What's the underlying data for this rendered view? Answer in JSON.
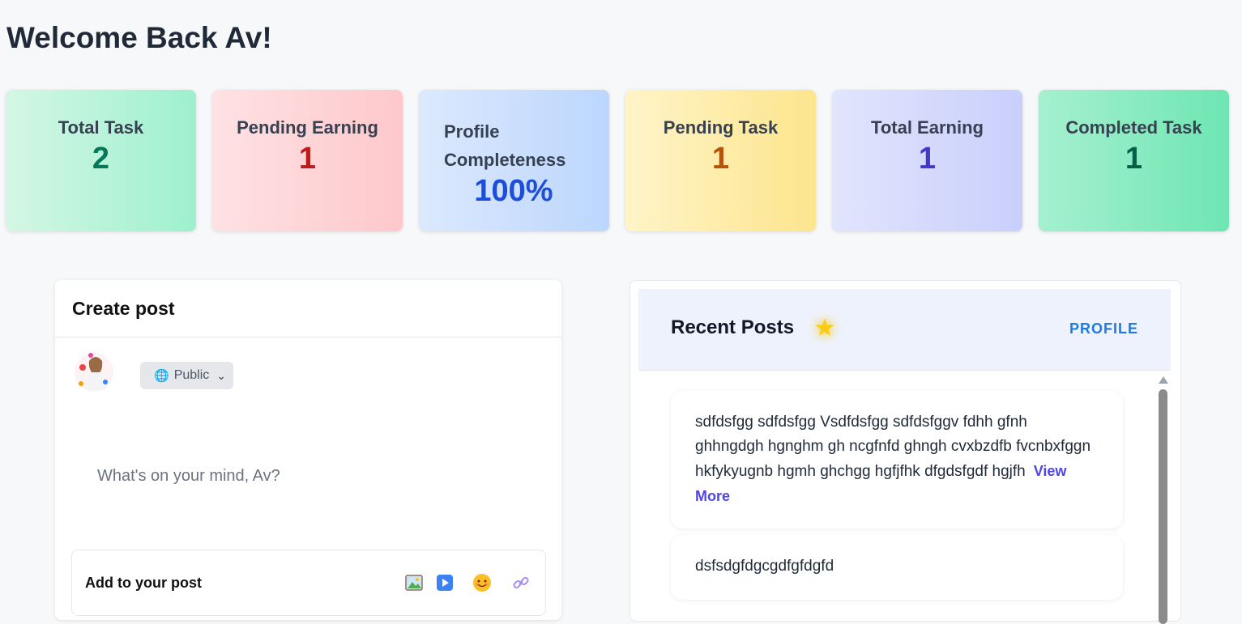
{
  "welcome": "Welcome Back Av!",
  "stats": [
    {
      "label": "Total Task",
      "value": "2",
      "color": "#047857"
    },
    {
      "label": "Pending Earning",
      "value": "1",
      "color": "#b91c1c"
    },
    {
      "label": "Profile Completeness",
      "value": "100%",
      "color": "#1d4ed8"
    },
    {
      "label": "Pending Task",
      "value": "1",
      "color": "#b45309"
    },
    {
      "label": "Total Earning",
      "value": "1",
      "color": "#4338ca"
    },
    {
      "label": "Completed Task",
      "value": "1",
      "color": "#065f46"
    }
  ],
  "create_post": {
    "title": "Create post",
    "privacy": "Public",
    "placeholder": "What's on your mind, Av?",
    "add_label": "Add to your post",
    "icons": [
      "image-icon",
      "video-icon",
      "emoji-icon",
      "link-icon"
    ]
  },
  "recent_posts": {
    "title": "Recent Posts",
    "profile_link": "PROFILE",
    "posts": [
      {
        "text": "sdfdsfgg sdfdsfgg Vsdfdsfgg sdfdsfggv fdhh gfnh ghhngdgh hgnghm gh ncgfnfd ghngh cvxbzdfb fvcnbxfggn hkfykyugnb hgmh ghchgg hgfjfhk dfgdsfgdf hgjfh",
        "more": "View More"
      },
      {
        "text": "dsfsdgfdgcgdfgfdgfd"
      }
    ]
  }
}
